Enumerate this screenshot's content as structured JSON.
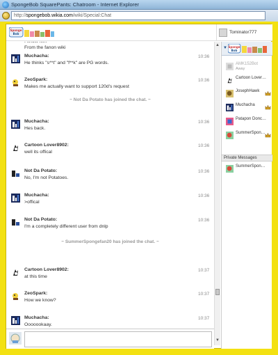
{
  "browser": {
    "title": "SpongeBob SquarePants: Chatroom - Internet Explorer",
    "url_prefix": "http://",
    "url_host": "spongebob.wikia.com",
    "url_path": "/wiki/Special:Chat"
  },
  "header": {
    "current_user": "Tominator777"
  },
  "messages": [
    {
      "kind": "continuation",
      "lines": [
        "I know him",
        "From the fanon wiki"
      ]
    },
    {
      "kind": "msg",
      "user": "Muchacha:",
      "time": "10:36",
      "text": "He thinks \"s**t\" and \"f**k\" are PG words.",
      "avatar": "muchacha"
    },
    {
      "kind": "msg",
      "user": "ZeoSpark:",
      "time": "10:36",
      "text": "Makes me actually want to support 120d's request",
      "avatar": "zeospark"
    },
    {
      "kind": "notice",
      "text": "~ Not Da Potato has joined the chat. ~"
    },
    {
      "kind": "msg",
      "user": "Muchacha:",
      "time": "10:36",
      "text": "Hes back.",
      "avatar": "muchacha"
    },
    {
      "kind": "msg",
      "user": "Cartoon Lover8902:",
      "time": "10:36",
      "text": "well its offical",
      "avatar": "cartoon"
    },
    {
      "kind": "msg",
      "user": "Not Da Potato:",
      "time": "10:36",
      "text": "No, I'm not Potatoes.",
      "avatar": "potato"
    },
    {
      "kind": "msg",
      "user": "Muchacha:",
      "time": "10:36",
      "text": ">offical",
      "avatar": "muchacha"
    },
    {
      "kind": "msg",
      "user": "Not Da Potato:",
      "time": "10:36",
      "text": "I'm a completely different user from dnlp",
      "avatar": "potato"
    },
    {
      "kind": "notice",
      "text": "~ SummerSpongefan20 has joined the chat. ~"
    },
    {
      "kind": "msg",
      "user": "Cartoon Lover8902:",
      "time": "10:37",
      "text": "at this time",
      "avatar": "cartoon"
    },
    {
      "kind": "msg",
      "user": "ZeoSpark:",
      "time": "10:37",
      "text": "How we know?",
      "avatar": "zeospark"
    },
    {
      "kind": "msg",
      "user": "Muchacha:",
      "time": "10:37",
      "text": "Ooooookaay.",
      "avatar": "muchacha"
    }
  ],
  "sidebar": {
    "users": [
      {
        "name": "AMK152Bot",
        "status": "Away",
        "avatar": "bot",
        "badge": false,
        "away": true
      },
      {
        "name": "Cartoon Lover…",
        "status": "",
        "avatar": "cartoon",
        "badge": false,
        "away": false
      },
      {
        "name": "JosephHawk",
        "status": "",
        "avatar": "joseph",
        "badge": true,
        "away": false
      },
      {
        "name": "Muchacha",
        "status": "",
        "avatar": "muchacha",
        "badge": true,
        "away": false
      },
      {
        "name": "Patapon Donc…",
        "status": "",
        "avatar": "patapon",
        "badge": false,
        "away": false
      },
      {
        "name": "SummerSpon…",
        "status": "",
        "avatar": "summer",
        "badge": true,
        "away": false
      }
    ],
    "private_messages_label": "Private Messages",
    "private_users": [
      {
        "name": "SummerSpon…",
        "avatar": "summer",
        "badge": false
      }
    ]
  },
  "colors": {
    "frame": "#f3e112",
    "badge": "#d9a520"
  }
}
